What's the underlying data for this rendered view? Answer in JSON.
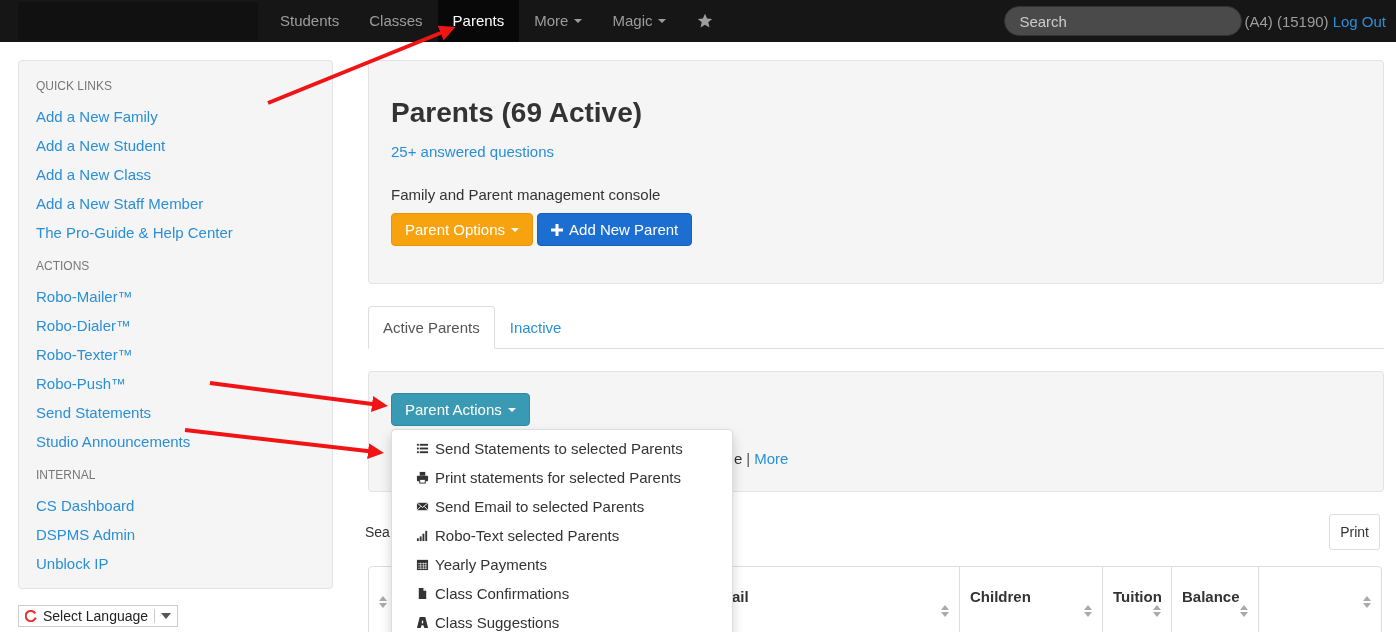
{
  "navbar": {
    "items": [
      {
        "label": "Students",
        "selected": false,
        "caret": false
      },
      {
        "label": "Classes",
        "selected": false,
        "caret": false
      },
      {
        "label": "Parents",
        "selected": true,
        "caret": false
      },
      {
        "label": "More",
        "selected": false,
        "caret": true
      },
      {
        "label": "Magic",
        "selected": false,
        "caret": true
      }
    ],
    "search": {
      "placeholder": "Search"
    },
    "account": "(A4) (15190)",
    "logout": "Log Out"
  },
  "sidebar": {
    "sections": [
      {
        "heading": "QUICK LINKS",
        "links": [
          "Add a New Family",
          "Add a New Student",
          "Add a New Class",
          "Add a New Staff Member",
          "The Pro-Guide & Help Center"
        ]
      },
      {
        "heading": "ACTIONS",
        "links": [
          "Robo-Mailer™",
          "Robo-Dialer™",
          "Robo-Texter™",
          "Robo-Push™",
          "Send Statements",
          "Studio Announcements"
        ]
      },
      {
        "heading": "INTERNAL",
        "links": [
          "CS Dashboard",
          "DSPMS Admin",
          "Unblock IP"
        ]
      }
    ],
    "language": "Select Language"
  },
  "header": {
    "title": "Parents (69 Active)",
    "help_link": "25+ answered questions",
    "description": "Family and Parent management console",
    "buttons": [
      {
        "label": "Parent Options",
        "kind": "dropdown"
      },
      {
        "label": "Add New Parent",
        "kind": "add"
      }
    ]
  },
  "tabs": [
    {
      "label": "Active Parents",
      "selected": true
    },
    {
      "label": "Inactive",
      "selected": false
    }
  ],
  "actions": {
    "button": "Parent Actions",
    "text_fragment": "e",
    "separator": "|",
    "more_link": "More",
    "menu": [
      "Send Statements to selected Parents",
      "Print statements for selected Parents",
      "Send Email to selected Parents",
      "Robo-Text selected Parents",
      "Yearly Payments",
      "Class Confirmations",
      "Class Suggestions"
    ]
  },
  "search_label": "Sea",
  "print_button": "Print",
  "table": {
    "columns": [
      {},
      {
        "label": "ail"
      },
      {
        "label": "Children"
      },
      {
        "label": "Tuition"
      },
      {
        "label": "Balance"
      },
      {}
    ]
  }
}
